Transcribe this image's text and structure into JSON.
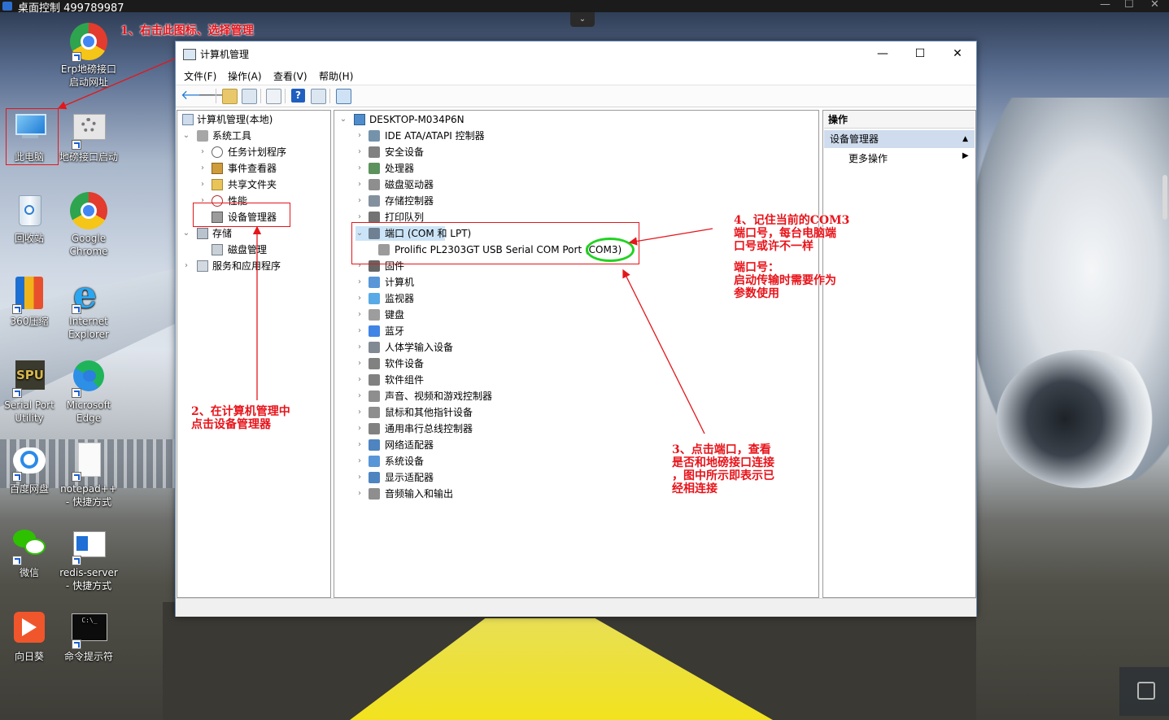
{
  "remote": {
    "title": "桌面控制 499789987"
  },
  "desktop_icons": [
    {
      "id": "erp",
      "label": "Erp地磅接口启动网址"
    },
    {
      "id": "pc",
      "label": "此电脑"
    },
    {
      "id": "weigh",
      "label": "地磅接口启动"
    },
    {
      "id": "recycle",
      "label": "回收站"
    },
    {
      "id": "chrome",
      "label": "Google Chrome"
    },
    {
      "id": "zip",
      "label": "360压缩"
    },
    {
      "id": "ie",
      "label": "Internet Explorer"
    },
    {
      "id": "spu",
      "label": "Serial Port Utility"
    },
    {
      "id": "edge",
      "label": "Microsoft Edge"
    },
    {
      "id": "baidu",
      "label": "百度网盘"
    },
    {
      "id": "notepad",
      "label": "notepad++ - 快捷方式"
    },
    {
      "id": "wechat",
      "label": "微信"
    },
    {
      "id": "redis",
      "label": "redis-server - 快捷方式"
    },
    {
      "id": "sunflower",
      "label": "向日葵"
    },
    {
      "id": "cmd",
      "label": "命令提示符"
    }
  ],
  "window": {
    "title": "计算机管理",
    "controls": {
      "minimize": "—",
      "maximize": "☐",
      "close": "✕"
    },
    "menu": [
      "文件(F)",
      "操作(A)",
      "查看(V)",
      "帮助(H)"
    ]
  },
  "left_tree": [
    {
      "label": "计算机管理(本地)",
      "arrow": ""
    },
    {
      "label": "系统工具",
      "arrow": "⌄"
    },
    {
      "label": "任务计划程序",
      "arrow": "›"
    },
    {
      "label": "事件查看器",
      "arrow": "›"
    },
    {
      "label": "共享文件夹",
      "arrow": "›"
    },
    {
      "label": "性能",
      "arrow": "›"
    },
    {
      "label": "设备管理器",
      "arrow": ""
    },
    {
      "label": "存储",
      "arrow": "⌄"
    },
    {
      "label": "磁盘管理",
      "arrow": ""
    },
    {
      "label": "服务和应用程序",
      "arrow": "›"
    }
  ],
  "device_tree": {
    "root": "DESKTOP-M034P6N",
    "items": [
      "IDE ATA/ATAPI 控制器",
      "安全设备",
      "处理器",
      "磁盘驱动器",
      "存储控制器",
      "打印队列",
      "端口 (COM 和 LPT)",
      "Prolific PL2303GT USB Serial COM Port (COM3)",
      "固件",
      "计算机",
      "监视器",
      "键盘",
      "蓝牙",
      "人体学输入设备",
      "软件设备",
      "软件组件",
      "声音、视频和游戏控制器",
      "鼠标和其他指针设备",
      "通用串行总线控制器",
      "网络适配器",
      "系统设备",
      "显示适配器",
      "音频输入和输出"
    ]
  },
  "actions": {
    "header": "操作",
    "item": "设备管理器",
    "more": "更多操作"
  },
  "annotations": {
    "a1": "1、右击此图标、选择管理",
    "a2": "2、在计算机管理中\n点击设备管理器",
    "a3": "3、点击端口，查看\n是否和地磅接口连接\n，图中所示即表示已\n经相连接",
    "a4": "4、记住当前的COM3\n端口号，每台电脑端\n口号或许不一样",
    "a5": "端口号：\n启动传输时需要作为\n参数使用"
  }
}
